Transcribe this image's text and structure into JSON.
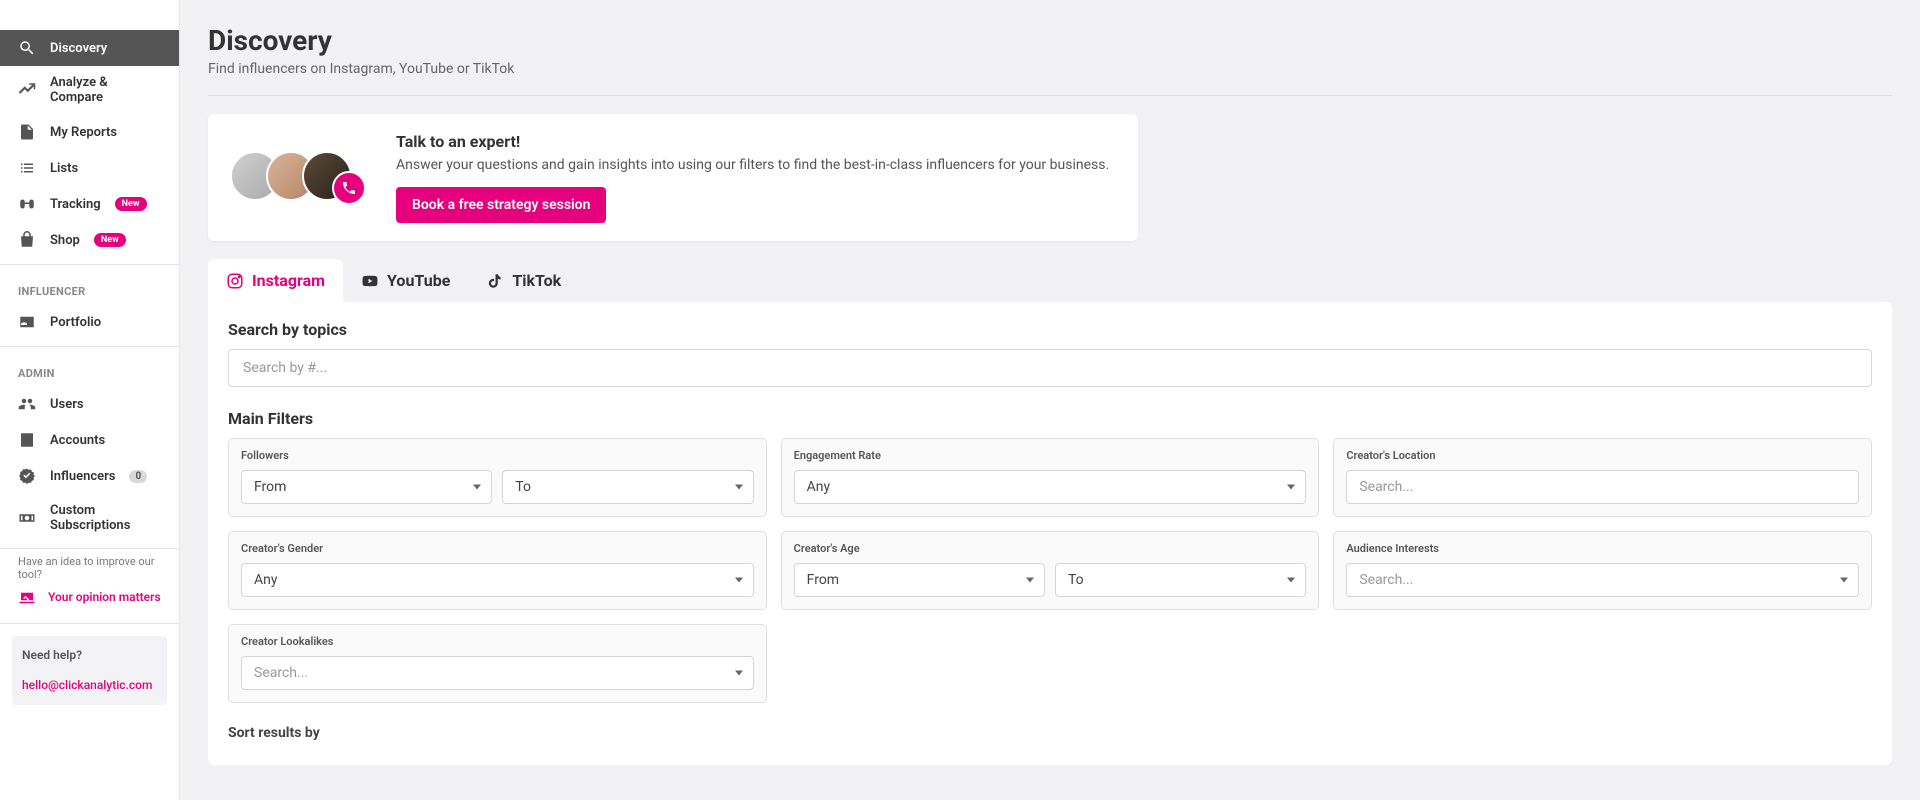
{
  "sidebar": {
    "nav": [
      {
        "label": "Discovery",
        "icon": "search",
        "active": true
      },
      {
        "label": "Analyze & Compare",
        "icon": "chart"
      },
      {
        "label": "My Reports",
        "icon": "file"
      },
      {
        "label": "Lists",
        "icon": "list"
      },
      {
        "label": "Tracking",
        "icon": "binoculars",
        "badge": "New"
      },
      {
        "label": "Shop",
        "icon": "bag",
        "badge": "New"
      }
    ],
    "sections": {
      "influencer": {
        "heading": "INFLUENCER",
        "items": [
          {
            "label": "Portfolio",
            "icon": "id-card"
          }
        ]
      },
      "admin": {
        "heading": "ADMIN",
        "items": [
          {
            "label": "Users",
            "icon": "users"
          },
          {
            "label": "Accounts",
            "icon": "building"
          },
          {
            "label": "Influencers",
            "icon": "verified",
            "count": "0"
          },
          {
            "label": "Custom Subscriptions",
            "icon": "money"
          }
        ]
      }
    },
    "opinion": {
      "prompt": "Have an idea to improve our tool?",
      "link": "Your opinion matters"
    },
    "help": {
      "heading": "Need help?",
      "email": "hello@clickanalytic.com"
    }
  },
  "page": {
    "title": "Discovery",
    "subtitle": "Find influencers on Instagram, YouTube or TikTok"
  },
  "expert": {
    "title": "Talk to an expert!",
    "desc": "Answer your questions and gain insights into using our filters to find the best-in-class influencers for your business.",
    "cta": "Book a free strategy session"
  },
  "tabs": [
    {
      "label": "Instagram",
      "active": true
    },
    {
      "label": "YouTube"
    },
    {
      "label": "TikTok"
    }
  ],
  "topics": {
    "heading": "Search by topics",
    "placeholder": "Search by #..."
  },
  "filters": {
    "heading": "Main Filters",
    "followers": {
      "label": "Followers",
      "from": "From",
      "to": "To"
    },
    "engagement": {
      "label": "Engagement Rate",
      "value": "Any"
    },
    "location": {
      "label": "Creator's Location",
      "placeholder": "Search..."
    },
    "gender": {
      "label": "Creator's Gender",
      "value": "Any"
    },
    "age": {
      "label": "Creator's Age",
      "from": "From",
      "to": "To"
    },
    "interests": {
      "label": "Audience Interests",
      "placeholder": "Search..."
    },
    "lookalikes": {
      "label": "Creator Lookalikes",
      "placeholder": "Search..."
    }
  },
  "sort": {
    "label": "Sort results by"
  }
}
